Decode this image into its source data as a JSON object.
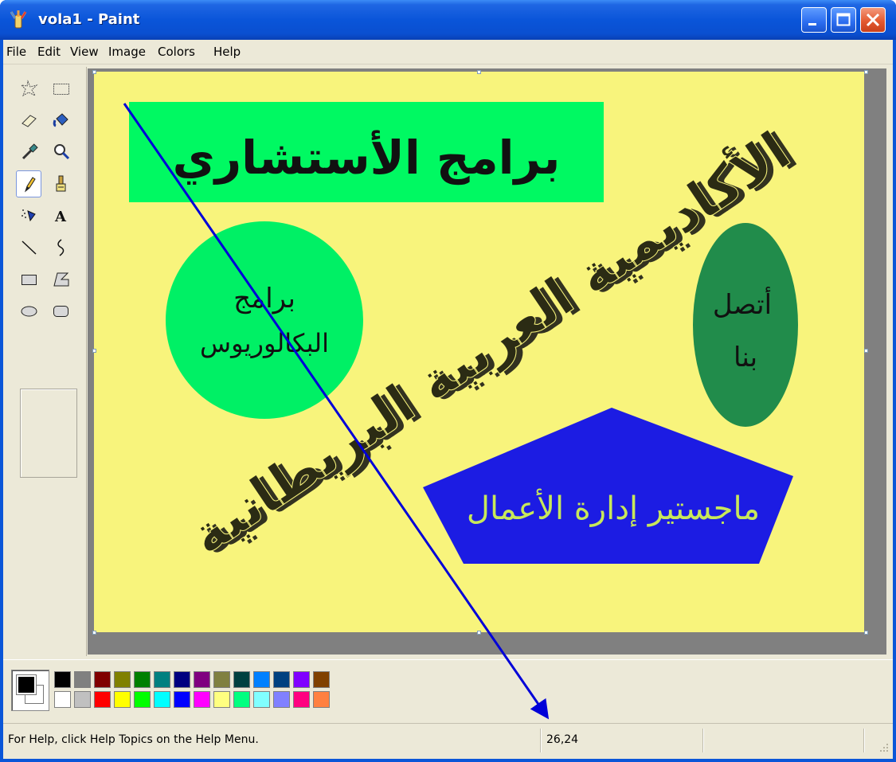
{
  "window": {
    "title": "vola1 - Paint"
  },
  "menu": [
    "File",
    "Edit",
    "View",
    "Image",
    "Colors",
    "Help"
  ],
  "tools": [
    {
      "name": "free-form-select",
      "icon": "free-select-icon"
    },
    {
      "name": "select",
      "icon": "rect-select-icon"
    },
    {
      "name": "eraser",
      "icon": "eraser-icon"
    },
    {
      "name": "fill-with-color",
      "icon": "fill-bucket-icon"
    },
    {
      "name": "pick-color",
      "icon": "eyedropper-icon"
    },
    {
      "name": "magnifier",
      "icon": "magnifier-icon"
    },
    {
      "name": "pencil",
      "icon": "pencil-icon",
      "active": true
    },
    {
      "name": "brush",
      "icon": "brush-icon"
    },
    {
      "name": "airbrush",
      "icon": "airbrush-icon"
    },
    {
      "name": "text",
      "icon": "text-tool-icon",
      "glyph": "A"
    },
    {
      "name": "line",
      "icon": "line-icon"
    },
    {
      "name": "curve",
      "icon": "curve-icon"
    },
    {
      "name": "rectangle",
      "icon": "rectangle-icon"
    },
    {
      "name": "polygon",
      "icon": "polygon-icon"
    },
    {
      "name": "ellipse",
      "icon": "ellipse-icon"
    },
    {
      "name": "rounded-rectangle",
      "icon": "rounded-rect-icon"
    }
  ],
  "canvas": {
    "banner_text": "برامج الأستشاري",
    "bachelor_line1": "برامج",
    "bachelor_line2": "البكالوريوس",
    "diagonal_text": "الأكاديمية العربية البريطانية",
    "contact_line1": "أتصل",
    "contact_line2": "بنا",
    "mba_text": "ماجستير إدارة الأعمال",
    "colors": {
      "background": "#f8f47c",
      "banner": "#00f962",
      "circle": "#00f065",
      "ellipse": "#218c4b",
      "pentagon": "#1c1ce3",
      "mba_text": "#c8e85a",
      "arrow": "#0000d8"
    }
  },
  "palette": {
    "foreground": "#000000",
    "background": "#ffffff",
    "row1": [
      "#000000",
      "#808080",
      "#800000",
      "#808000",
      "#008000",
      "#008080",
      "#000080",
      "#800080",
      "#808040",
      "#004040",
      "#0080ff",
      "#004080",
      "#8000ff",
      "#804000"
    ],
    "row2": [
      "#ffffff",
      "#c0c0c0",
      "#ff0000",
      "#ffff00",
      "#00ff00",
      "#00ffff",
      "#0000ff",
      "#ff00ff",
      "#ffff80",
      "#00ff80",
      "#80ffff",
      "#8080ff",
      "#ff0080",
      "#ff8040"
    ]
  },
  "status": {
    "help_text": "For Help, click Help Topics on the Help Menu.",
    "coords": "26,24"
  }
}
